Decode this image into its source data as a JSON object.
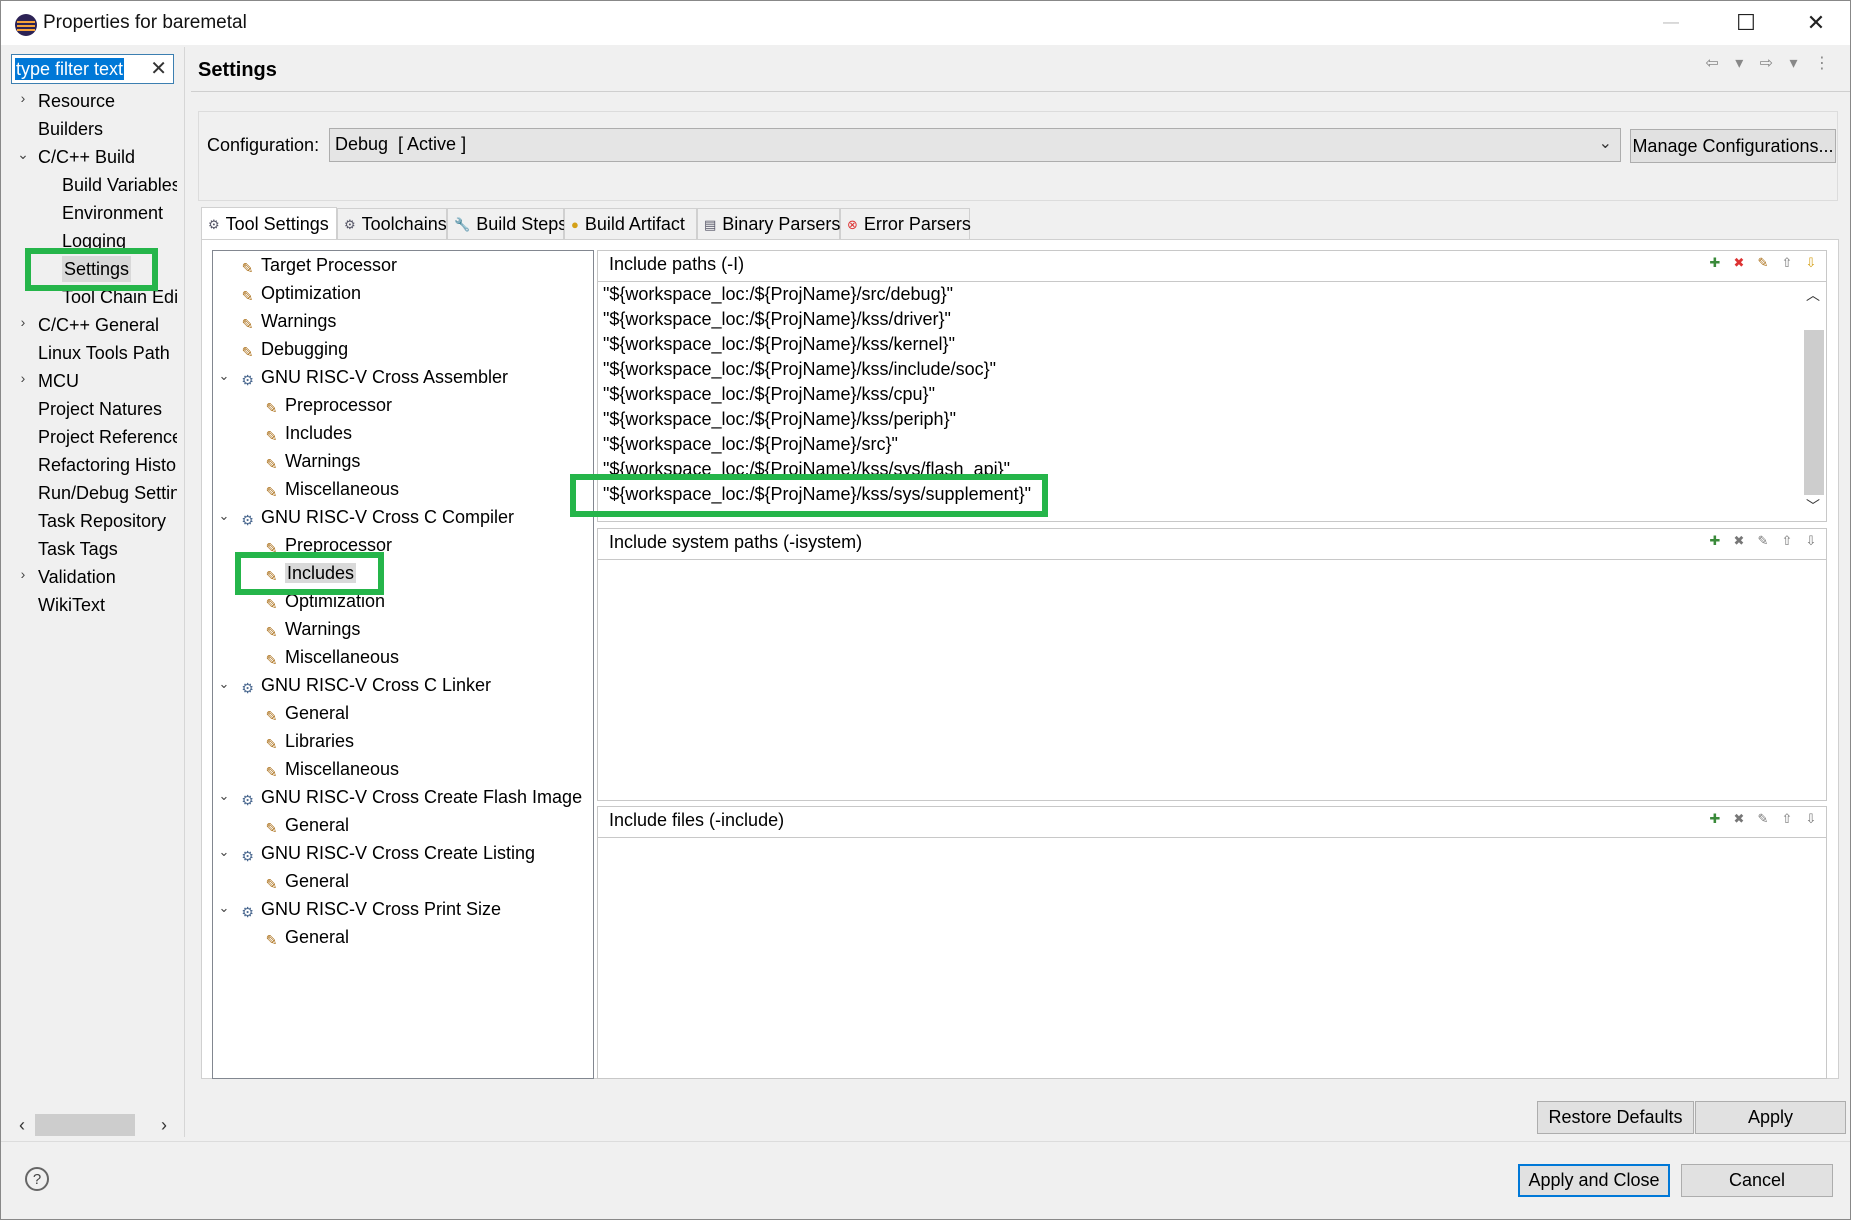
{
  "window": {
    "title": "Properties for baremetal",
    "minimize_label": "—",
    "maximize_label": "☐",
    "close_label": "✕"
  },
  "filter": {
    "value": "type filter text",
    "clear_label": "✕"
  },
  "left_nav": {
    "items": [
      {
        "label": "Resource",
        "expander": "›"
      },
      {
        "label": "Builders"
      },
      {
        "label": "C/C++ Build",
        "expander": "⌄"
      },
      {
        "label": "Build Variables"
      },
      {
        "label": "Environment"
      },
      {
        "label": "Logging"
      },
      {
        "label": "Settings",
        "selected": true
      },
      {
        "label": "Tool Chain Edi"
      },
      {
        "label": "C/C++ General",
        "expander": "›"
      },
      {
        "label": "Linux Tools Path"
      },
      {
        "label": "MCU",
        "expander": "›"
      },
      {
        "label": "Project Natures"
      },
      {
        "label": "Project References"
      },
      {
        "label": "Refactoring History"
      },
      {
        "label": "Run/Debug Settings"
      },
      {
        "label": "Task Repository"
      },
      {
        "label": "Task Tags"
      },
      {
        "label": "Validation",
        "expander": "›"
      },
      {
        "label": "WikiText"
      }
    ],
    "scroll_left": "‹",
    "scroll_right": "›"
  },
  "page": {
    "title": "Settings",
    "nav_arrows": "⇦ ▾ ⇨ ▾ ⋮"
  },
  "config": {
    "label": "Configuration:",
    "value": "Debug  [ Active ]",
    "manage_label": "Manage Configurations..."
  },
  "tabs": [
    {
      "label": "Tool Settings",
      "icon": "gear-icon",
      "active": true
    },
    {
      "label": "Toolchains",
      "icon": "gear-icon"
    },
    {
      "label": "Build Steps",
      "icon": "wrench-icon"
    },
    {
      "label": "Build Artifact",
      "icon": "artifact-icon"
    },
    {
      "label": "Binary Parsers",
      "icon": "binary-icon"
    },
    {
      "label": "Error Parsers",
      "icon": "error-icon"
    }
  ],
  "tool_tree": [
    {
      "label": "Target Processor",
      "level": 0
    },
    {
      "label": "Optimization",
      "level": 0
    },
    {
      "label": "Warnings",
      "level": 0
    },
    {
      "label": "Debugging",
      "level": 0
    },
    {
      "label": "GNU RISC-V Cross Assembler",
      "level": 0,
      "group": true
    },
    {
      "label": "Preprocessor",
      "level": 1
    },
    {
      "label": "Includes",
      "level": 1
    },
    {
      "label": "Warnings",
      "level": 1
    },
    {
      "label": "Miscellaneous",
      "level": 1
    },
    {
      "label": "GNU RISC-V Cross C Compiler",
      "level": 0,
      "group": true
    },
    {
      "label": "Preprocessor",
      "level": 1
    },
    {
      "label": "Includes",
      "level": 1,
      "selected": true
    },
    {
      "label": "Optimization",
      "level": 1
    },
    {
      "label": "Warnings",
      "level": 1
    },
    {
      "label": "Miscellaneous",
      "level": 1
    },
    {
      "label": "GNU RISC-V Cross C Linker",
      "level": 0,
      "group": true
    },
    {
      "label": "General",
      "level": 1
    },
    {
      "label": "Libraries",
      "level": 1
    },
    {
      "label": "Miscellaneous",
      "level": 1
    },
    {
      "label": "GNU RISC-V Cross Create Flash Image",
      "level": 0,
      "group": true
    },
    {
      "label": "General",
      "level": 1
    },
    {
      "label": "GNU RISC-V Cross Create Listing",
      "level": 0,
      "group": true
    },
    {
      "label": "General",
      "level": 1
    },
    {
      "label": "GNU RISC-V Cross Print Size",
      "level": 0,
      "group": true
    },
    {
      "label": "General",
      "level": 1
    }
  ],
  "include_paths": {
    "title": "Include paths (-I)",
    "items": [
      "\"${workspace_loc:/${ProjName}/src/debug}\"",
      "\"${workspace_loc:/${ProjName}/kss/driver}\"",
      "\"${workspace_loc:/${ProjName}/kss/kernel}\"",
      "\"${workspace_loc:/${ProjName}/kss/include/soc}\"",
      "\"${workspace_loc:/${ProjName}/kss/cpu}\"",
      "\"${workspace_loc:/${ProjName}/kss/periph}\"",
      "\"${workspace_loc:/${ProjName}/src}\"",
      "\"${workspace_loc:/${ProjName}/kss/sys/flash_api}\"",
      "\"${workspace_loc:/${ProjName}/kss/sys/supplement}\""
    ]
  },
  "include_system_paths": {
    "title": "Include system paths (-isystem)",
    "items": []
  },
  "include_files": {
    "title": "Include files (-include)",
    "items": []
  },
  "section_toolbar": [
    "add",
    "delete",
    "edit",
    "move-up",
    "move-down"
  ],
  "buttons": {
    "restore_defaults": "Restore Defaults",
    "apply": "Apply",
    "apply_and_close": "Apply and Close",
    "cancel": "Cancel",
    "help": "?"
  },
  "colors": {
    "highlight_box": "#25b54a",
    "selection": "#0078d7"
  }
}
